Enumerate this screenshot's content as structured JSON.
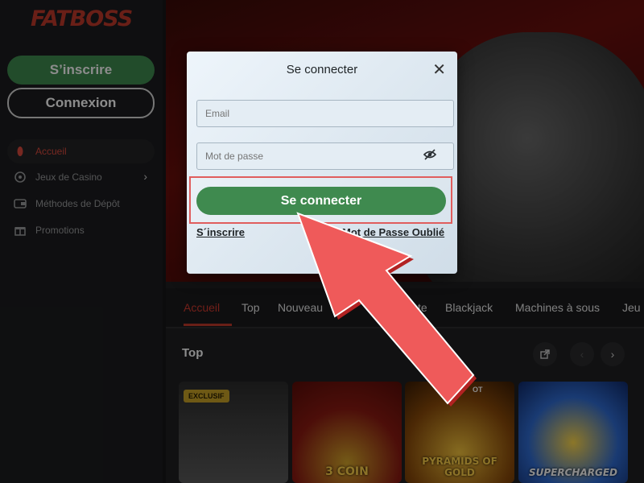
{
  "brand": {
    "logo_text": "FATBOSS",
    "accent": "#c0392b",
    "green": "#3f8a4f"
  },
  "sidebar": {
    "signup_label": "S’inscrire",
    "login_label": "Connexion",
    "items": [
      {
        "label": "Accueil",
        "icon": "home-icon",
        "active": true
      },
      {
        "label": "Jeux de Casino",
        "icon": "casino-icon"
      },
      {
        "label": "Méthodes de Dépôt",
        "icon": "wallet-icon"
      },
      {
        "label": "Promotions",
        "icon": "gift-icon"
      }
    ]
  },
  "tabs": [
    "Accueil",
    "Top",
    "Nouveau",
    "te",
    "Blackjack",
    "Machines à sous",
    "Jeu"
  ],
  "section": {
    "title": "Top"
  },
  "games": [
    {
      "badge": "EXCLUSIF",
      "title": ""
    },
    {
      "badge": "",
      "title": "3 COIN"
    },
    {
      "badge": "OT",
      "title": "PYRAMIDS OF GOLD"
    },
    {
      "badge": "",
      "title": "SUPERCHARGED"
    }
  ],
  "modal": {
    "title": "Se connecter",
    "email_placeholder": "Email",
    "password_placeholder": "Mot de passe",
    "submit_label": "Se connecter",
    "signup_link": "S´inscrire",
    "forgot_link": "Mot de Passe Oublié"
  }
}
